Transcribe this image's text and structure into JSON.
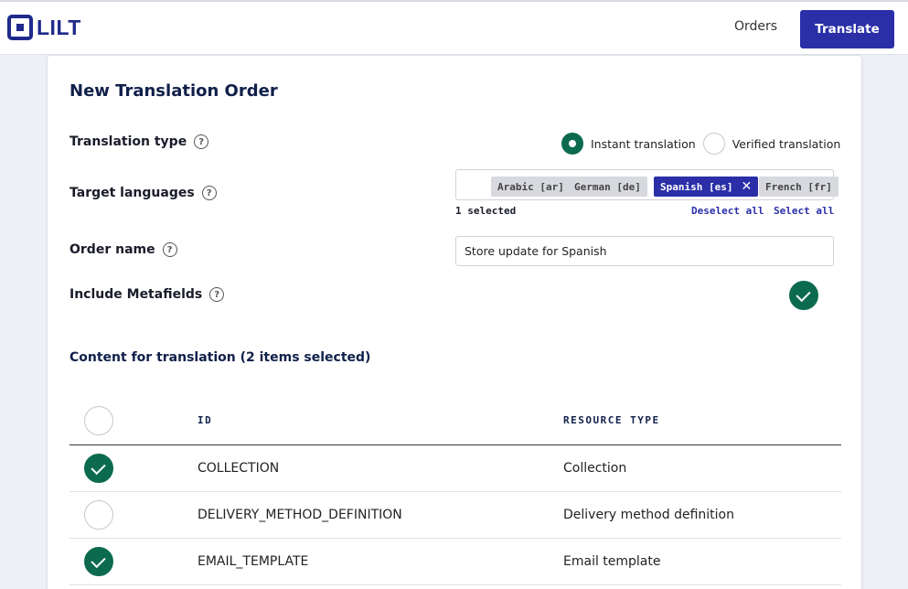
{
  "header": {
    "logo_text": "LILT",
    "orders_label": "Orders",
    "translate_label": "Translate"
  },
  "form": {
    "title": "New Translation Order",
    "translation_type": {
      "label": "Translation type",
      "options": [
        {
          "label": "Instant translation",
          "checked": true
        },
        {
          "label": "Verified translation",
          "checked": false
        }
      ]
    },
    "target_languages": {
      "label": "Target languages",
      "chips": [
        {
          "label": "Arabic [ar]",
          "selected": false
        },
        {
          "label": "German [de]",
          "selected": false
        },
        {
          "label": "Spanish [es]",
          "selected": true
        },
        {
          "label": "French [fr]",
          "selected": false
        }
      ],
      "remove_symbol": "✕",
      "selected_count": "1 selected",
      "deselect_all": "Deselect all",
      "select_all": "Select all"
    },
    "order_name": {
      "label": "Order name",
      "value": "Store update for Spanish"
    },
    "include_metafields": {
      "label": "Include Metafields",
      "checked": true
    },
    "help_symbol": "?"
  },
  "content": {
    "title": "Content for translation (2 items selected)",
    "columns": {
      "id": "ID",
      "type": "RESOURCE TYPE"
    },
    "rows": [
      {
        "id": "COLLECTION",
        "type": "Collection",
        "checked": true
      },
      {
        "id": "DELIVERY_METHOD_DEFINITION",
        "type": "Delivery method definition",
        "checked": false
      },
      {
        "id": "EMAIL_TEMPLATE",
        "type": "Email template",
        "checked": true
      }
    ]
  },
  "colors": {
    "brand": "#2a2fa8",
    "logo": "#1f2a8c",
    "check_green": "#0c6b4f",
    "heading": "#11204a"
  }
}
